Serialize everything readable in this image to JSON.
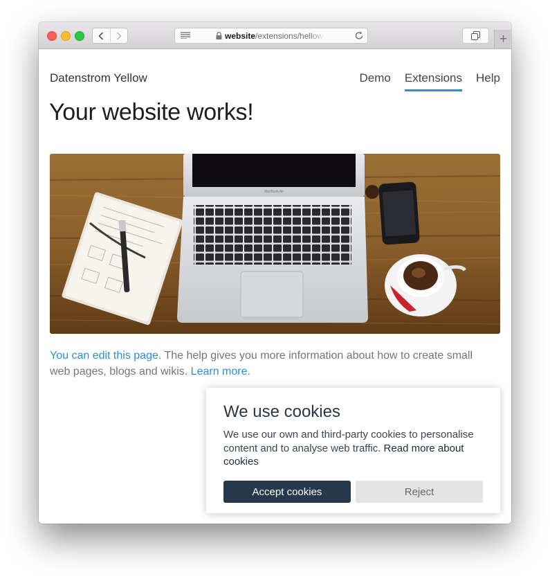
{
  "browser": {
    "url_host": "website",
    "url_path": "/extensions/hellow",
    "new_tab_label": "+"
  },
  "site": {
    "title": "Datenstrom Yellow",
    "nav": [
      {
        "label": "Demo",
        "active": false
      },
      {
        "label": "Extensions",
        "active": true
      },
      {
        "label": "Help",
        "active": false
      }
    ],
    "accent_color": "#2a8fd6"
  },
  "page": {
    "heading": "Your website works!",
    "hero_image": "laptop-desk-photo",
    "hero_laptop_brand": "MacBook Air",
    "edit_link": "You can edit this page",
    "text_middle": ". The help gives you more information about how to create small web pages, blogs and wikis. ",
    "learn_more_link": "Learn more",
    "text_end": "."
  },
  "cookie_banner": {
    "title": "We use cookies",
    "text": "We use our own and third-party cookies to personalise content and to analyse web traffic. ",
    "link": "Read more about cookies",
    "accept_label": "Accept cookies",
    "reject_label": "Reject",
    "accept_color": "#26394a"
  }
}
